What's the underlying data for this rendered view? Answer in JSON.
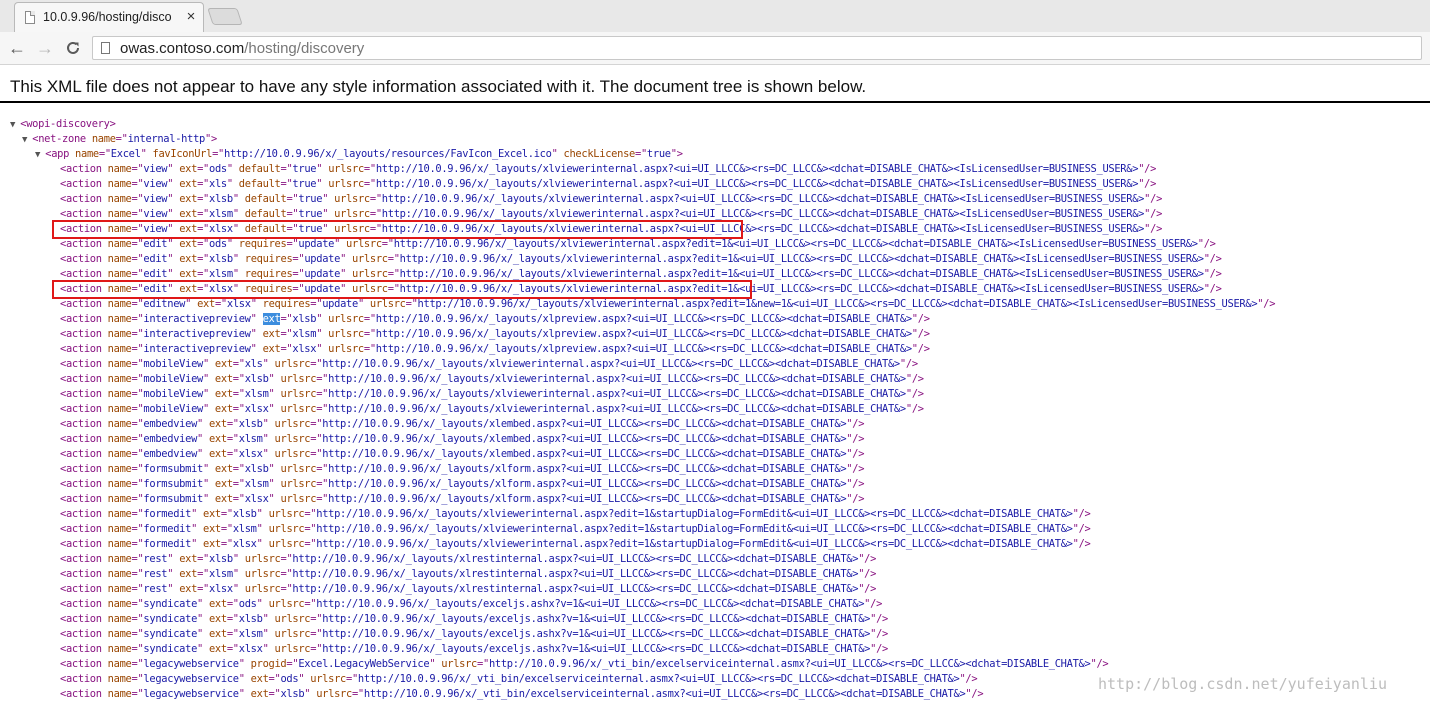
{
  "browser": {
    "tab_title": "10.0.9.96/hosting/disco",
    "tab_close": "×",
    "back_glyph": "←",
    "forward_glyph": "→",
    "reload_glyph": "C",
    "url_host": "owas.contoso.com",
    "url_path": "/hosting/discovery"
  },
  "notice": "This XML file does not appear to have any style information associated with it. The document tree is shown below.",
  "tree": {
    "root": "wopi-discovery",
    "net_zone": {
      "name": "internal-http"
    },
    "app": {
      "name": "Excel",
      "favIconUrl": "http://10.0.9.96/x/_layouts/resources/FavIcon_Excel.ico",
      "checkLicense": "true"
    },
    "actions": [
      {
        "name": "view",
        "ext": "ods",
        "default": "true",
        "urlsrc": "http://10.0.9.96/x/_layouts/xlviewerinternal.aspx?<ui=UI_LLCC&><rs=DC_LLCC&><dchat=DISABLE_CHAT&><IsLicensedUser=BUSINESS_USER&>"
      },
      {
        "name": "view",
        "ext": "xls",
        "default": "true",
        "urlsrc": "http://10.0.9.96/x/_layouts/xlviewerinternal.aspx?<ui=UI_LLCC&><rs=DC_LLCC&><dchat=DISABLE_CHAT&><IsLicensedUser=BUSINESS_USER&>"
      },
      {
        "name": "view",
        "ext": "xlsb",
        "default": "true",
        "urlsrc": "http://10.0.9.96/x/_layouts/xlviewerinternal.aspx?<ui=UI_LLCC&><rs=DC_LLCC&><dchat=DISABLE_CHAT&><IsLicensedUser=BUSINESS_USER&>"
      },
      {
        "name": "view",
        "ext": "xlsm",
        "default": "true",
        "urlsrc": "http://10.0.9.96/x/_layouts/xlviewerinternal.aspx?<ui=UI_LLCC&><rs=DC_LLCC&><dchat=DISABLE_CHAT&><IsLicensedUser=BUSINESS_USER&>"
      },
      {
        "name": "view",
        "ext": "xlsx",
        "default": "true",
        "urlsrc": "http://10.0.9.96/x/_layouts/xlviewerinternal.aspx?<ui=UI_LLCC&><rs=DC_LLCC&><dchat=DISABLE_CHAT&><IsLicensedUser=BUSINESS_USER&>"
      },
      {
        "name": "edit",
        "ext": "ods",
        "requires": "update",
        "urlsrc": "http://10.0.9.96/x/_layouts/xlviewerinternal.aspx?edit=1&<ui=UI_LLCC&><rs=DC_LLCC&><dchat=DISABLE_CHAT&><IsLicensedUser=BUSINESS_USER&>"
      },
      {
        "name": "edit",
        "ext": "xlsb",
        "requires": "update",
        "urlsrc": "http://10.0.9.96/x/_layouts/xlviewerinternal.aspx?edit=1&<ui=UI_LLCC&><rs=DC_LLCC&><dchat=DISABLE_CHAT&><IsLicensedUser=BUSINESS_USER&>"
      },
      {
        "name": "edit",
        "ext": "xlsm",
        "requires": "update",
        "urlsrc": "http://10.0.9.96/x/_layouts/xlviewerinternal.aspx?edit=1&<ui=UI_LLCC&><rs=DC_LLCC&><dchat=DISABLE_CHAT&><IsLicensedUser=BUSINESS_USER&>"
      },
      {
        "name": "edit",
        "ext": "xlsx",
        "requires": "update",
        "urlsrc": "http://10.0.9.96/x/_layouts/xlviewerinternal.aspx?edit=1&<ui=UI_LLCC&><rs=DC_LLCC&><dchat=DISABLE_CHAT&><IsLicensedUser=BUSINESS_USER&>"
      },
      {
        "name": "editnew",
        "ext": "xlsx",
        "requires": "update",
        "urlsrc": "http://10.0.9.96/x/_layouts/xlviewerinternal.aspx?edit=1&new=1&<ui=UI_LLCC&><rs=DC_LLCC&><dchat=DISABLE_CHAT&><IsLicensedUser=BUSINESS_USER&>"
      },
      {
        "name": "interactivepreview",
        "ext": "xlsb",
        "urlsrc": "http://10.0.9.96/x/_layouts/xlpreview.aspx?<ui=UI_LLCC&><rs=DC_LLCC&><dchat=DISABLE_CHAT&>"
      },
      {
        "name": "interactivepreview",
        "ext": "xlsm",
        "urlsrc": "http://10.0.9.96/x/_layouts/xlpreview.aspx?<ui=UI_LLCC&><rs=DC_LLCC&><dchat=DISABLE_CHAT&>"
      },
      {
        "name": "interactivepreview",
        "ext": "xlsx",
        "urlsrc": "http://10.0.9.96/x/_layouts/xlpreview.aspx?<ui=UI_LLCC&><rs=DC_LLCC&><dchat=DISABLE_CHAT&>"
      },
      {
        "name": "mobileView",
        "ext": "xls",
        "urlsrc": "http://10.0.9.96/x/_layouts/xlviewerinternal.aspx?<ui=UI_LLCC&><rs=DC_LLCC&><dchat=DISABLE_CHAT&>"
      },
      {
        "name": "mobileView",
        "ext": "xlsb",
        "urlsrc": "http://10.0.9.96/x/_layouts/xlviewerinternal.aspx?<ui=UI_LLCC&><rs=DC_LLCC&><dchat=DISABLE_CHAT&>"
      },
      {
        "name": "mobileView",
        "ext": "xlsm",
        "urlsrc": "http://10.0.9.96/x/_layouts/xlviewerinternal.aspx?<ui=UI_LLCC&><rs=DC_LLCC&><dchat=DISABLE_CHAT&>"
      },
      {
        "name": "mobileView",
        "ext": "xlsx",
        "urlsrc": "http://10.0.9.96/x/_layouts/xlviewerinternal.aspx?<ui=UI_LLCC&><rs=DC_LLCC&><dchat=DISABLE_CHAT&>"
      },
      {
        "name": "embedview",
        "ext": "xlsb",
        "urlsrc": "http://10.0.9.96/x/_layouts/xlembed.aspx?<ui=UI_LLCC&><rs=DC_LLCC&><dchat=DISABLE_CHAT&>"
      },
      {
        "name": "embedview",
        "ext": "xlsm",
        "urlsrc": "http://10.0.9.96/x/_layouts/xlembed.aspx?<ui=UI_LLCC&><rs=DC_LLCC&><dchat=DISABLE_CHAT&>"
      },
      {
        "name": "embedview",
        "ext": "xlsx",
        "urlsrc": "http://10.0.9.96/x/_layouts/xlembed.aspx?<ui=UI_LLCC&><rs=DC_LLCC&><dchat=DISABLE_CHAT&>"
      },
      {
        "name": "formsubmit",
        "ext": "xlsb",
        "urlsrc": "http://10.0.9.96/x/_layouts/xlform.aspx?<ui=UI_LLCC&><rs=DC_LLCC&><dchat=DISABLE_CHAT&>"
      },
      {
        "name": "formsubmit",
        "ext": "xlsm",
        "urlsrc": "http://10.0.9.96/x/_layouts/xlform.aspx?<ui=UI_LLCC&><rs=DC_LLCC&><dchat=DISABLE_CHAT&>"
      },
      {
        "name": "formsubmit",
        "ext": "xlsx",
        "urlsrc": "http://10.0.9.96/x/_layouts/xlform.aspx?<ui=UI_LLCC&><rs=DC_LLCC&><dchat=DISABLE_CHAT&>"
      },
      {
        "name": "formedit",
        "ext": "xlsb",
        "urlsrc": "http://10.0.9.96/x/_layouts/xlviewerinternal.aspx?edit=1&startupDialog=FormEdit&<ui=UI_LLCC&><rs=DC_LLCC&><dchat=DISABLE_CHAT&>"
      },
      {
        "name": "formedit",
        "ext": "xlsm",
        "urlsrc": "http://10.0.9.96/x/_layouts/xlviewerinternal.aspx?edit=1&startupDialog=FormEdit&<ui=UI_LLCC&><rs=DC_LLCC&><dchat=DISABLE_CHAT&>"
      },
      {
        "name": "formedit",
        "ext": "xlsx",
        "urlsrc": "http://10.0.9.96/x/_layouts/xlviewerinternal.aspx?edit=1&startupDialog=FormEdit&<ui=UI_LLCC&><rs=DC_LLCC&><dchat=DISABLE_CHAT&>"
      },
      {
        "name": "rest",
        "ext": "xlsb",
        "urlsrc": "http://10.0.9.96/x/_layouts/xlrestinternal.aspx?<ui=UI_LLCC&><rs=DC_LLCC&><dchat=DISABLE_CHAT&>"
      },
      {
        "name": "rest",
        "ext": "xlsm",
        "urlsrc": "http://10.0.9.96/x/_layouts/xlrestinternal.aspx?<ui=UI_LLCC&><rs=DC_LLCC&><dchat=DISABLE_CHAT&>"
      },
      {
        "name": "rest",
        "ext": "xlsx",
        "urlsrc": "http://10.0.9.96/x/_layouts/xlrestinternal.aspx?<ui=UI_LLCC&><rs=DC_LLCC&><dchat=DISABLE_CHAT&>"
      },
      {
        "name": "syndicate",
        "ext": "ods",
        "urlsrc": "http://10.0.9.96/x/_layouts/exceljs.ashx?v=1&<ui=UI_LLCC&><rs=DC_LLCC&><dchat=DISABLE_CHAT&>"
      },
      {
        "name": "syndicate",
        "ext": "xlsb",
        "urlsrc": "http://10.0.9.96/x/_layouts/exceljs.ashx?v=1&<ui=UI_LLCC&><rs=DC_LLCC&><dchat=DISABLE_CHAT&>"
      },
      {
        "name": "syndicate",
        "ext": "xlsm",
        "urlsrc": "http://10.0.9.96/x/_layouts/exceljs.ashx?v=1&<ui=UI_LLCC&><rs=DC_LLCC&><dchat=DISABLE_CHAT&>"
      },
      {
        "name": "syndicate",
        "ext": "xlsx",
        "urlsrc": "http://10.0.9.96/x/_layouts/exceljs.ashx?v=1&<ui=UI_LLCC&><rs=DC_LLCC&><dchat=DISABLE_CHAT&>"
      },
      {
        "name": "legacywebservice",
        "progid": "Excel.LegacyWebService",
        "urlsrc": "http://10.0.9.96/x/_vti_bin/excelserviceinternal.asmx?<ui=UI_LLCC&><rs=DC_LLCC&><dchat=DISABLE_CHAT&>"
      },
      {
        "name": "legacywebservice",
        "ext": "ods",
        "urlsrc": "http://10.0.9.96/x/_vti_bin/excelserviceinternal.asmx?<ui=UI_LLCC&><rs=DC_LLCC&><dchat=DISABLE_CHAT&>"
      },
      {
        "name": "legacywebservice",
        "ext": "xlsb",
        "urlsrc": "http://10.0.9.96/x/_vti_bin/excelserviceinternal.asmx?<ui=UI_LLCC&><rs=DC_LLCC&><dchat=DISABLE_CHAT&>"
      }
    ]
  },
  "watermark": "http://blog.csdn.net/yufeiyanliu",
  "colors": {
    "tag": "#881280",
    "attr_name": "#994500",
    "attr_value": "#1a1aa6",
    "highlight_box": "#e01818",
    "selection": "#3c8dde"
  }
}
